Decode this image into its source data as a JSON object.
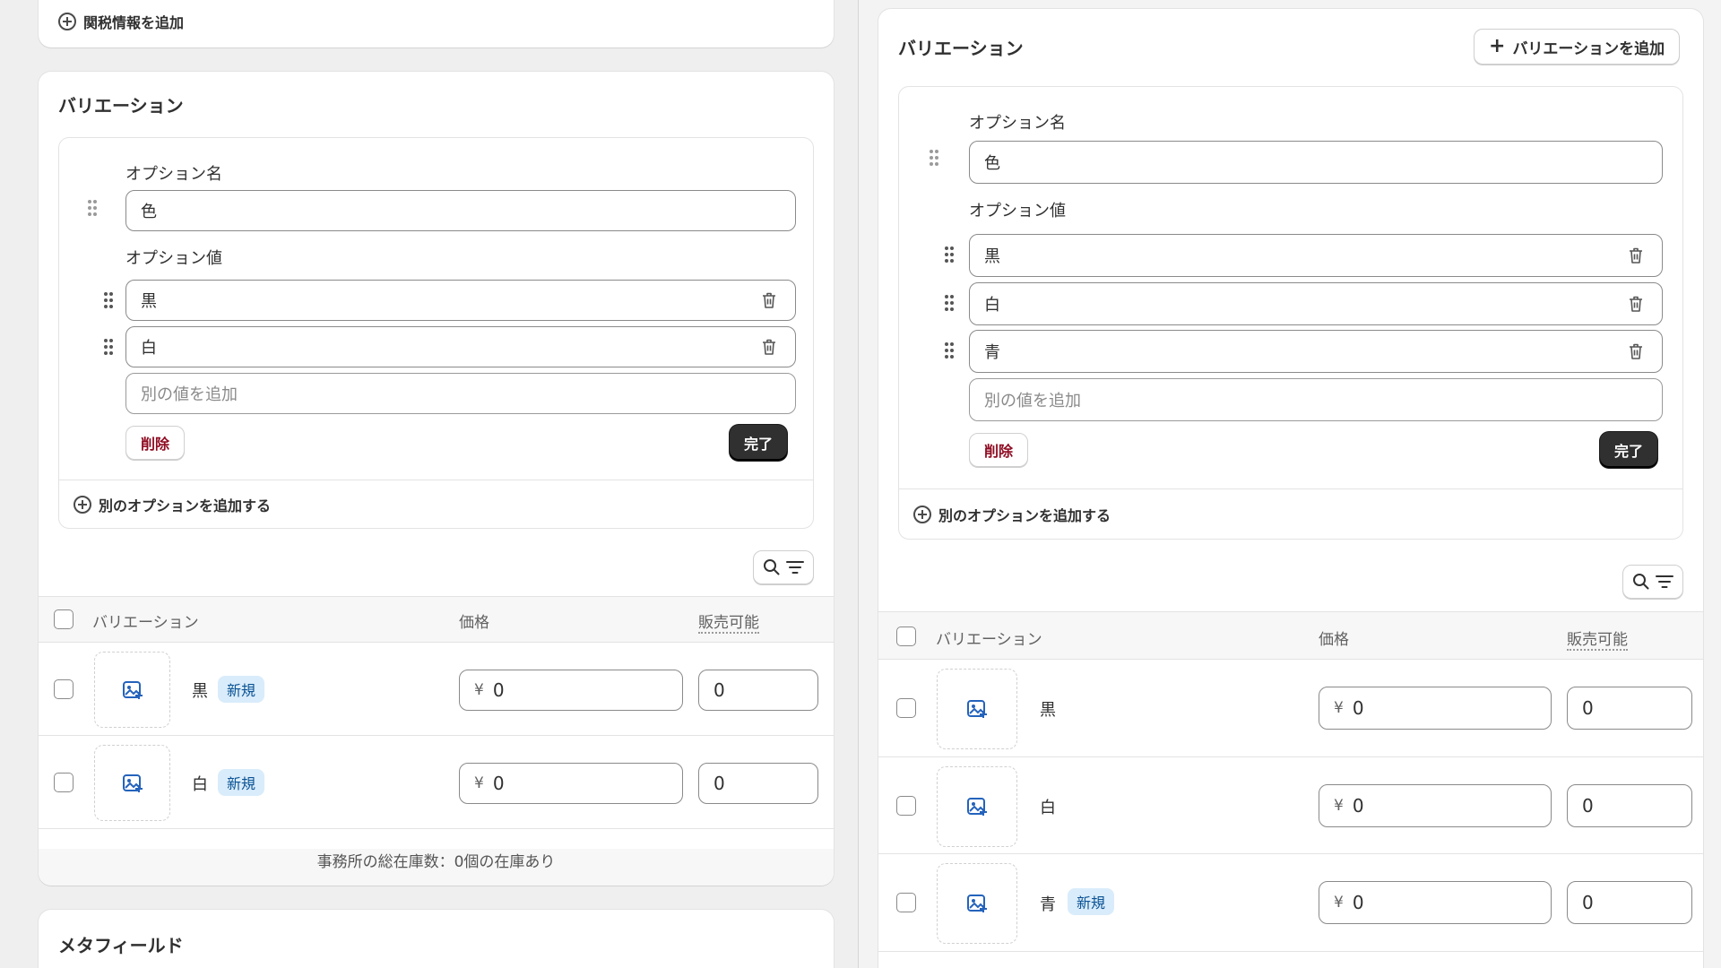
{
  "left": {
    "customs_link": "関税情報を追加",
    "variations_title": "バリエーション",
    "option_name_label": "オプション名",
    "option_name_value": "色",
    "option_values_label": "オプション値",
    "option_values": [
      "黒",
      "白"
    ],
    "add_value_placeholder": "別の値を追加",
    "delete_label": "削除",
    "done_label": "完了",
    "add_option_label": "別のオプションを追加する",
    "table": {
      "col_variation": "バリエーション",
      "col_price": "価格",
      "col_available": "販売可能",
      "rows": [
        {
          "name": "黒",
          "badge": "新規",
          "currency": "¥",
          "price": "0",
          "qty": "0"
        },
        {
          "name": "白",
          "badge": "新規",
          "currency": "¥",
          "price": "0",
          "qty": "0"
        }
      ],
      "inventory_note": "事務所の総在庫数：0個の在庫あり"
    },
    "metafields_title": "メタフィールド"
  },
  "right": {
    "variations_title": "バリエーション",
    "add_variation_button": "バリエーションを追加",
    "option_name_label": "オプション名",
    "option_name_value": "色",
    "option_values_label": "オプション値",
    "option_values": [
      "黒",
      "白",
      "青"
    ],
    "add_value_placeholder": "別の値を追加",
    "delete_label": "削除",
    "done_label": "完了",
    "add_option_label": "別のオプションを追加する",
    "table": {
      "col_variation": "バリエーション",
      "col_price": "価格",
      "col_available": "販売可能",
      "rows": [
        {
          "name": "黒",
          "badge": "",
          "currency": "¥",
          "price": "0",
          "qty": "0"
        },
        {
          "name": "白",
          "badge": "",
          "currency": "¥",
          "price": "0",
          "qty": "0"
        },
        {
          "name": "青",
          "badge": "新規",
          "currency": "¥",
          "price": "0",
          "qty": "0"
        }
      ]
    }
  },
  "colors": {
    "accent_blue": "#0b5394",
    "badge_bg": "#d9ecfb",
    "delete_red": "#8e0b21",
    "done_bg": "#303030"
  }
}
